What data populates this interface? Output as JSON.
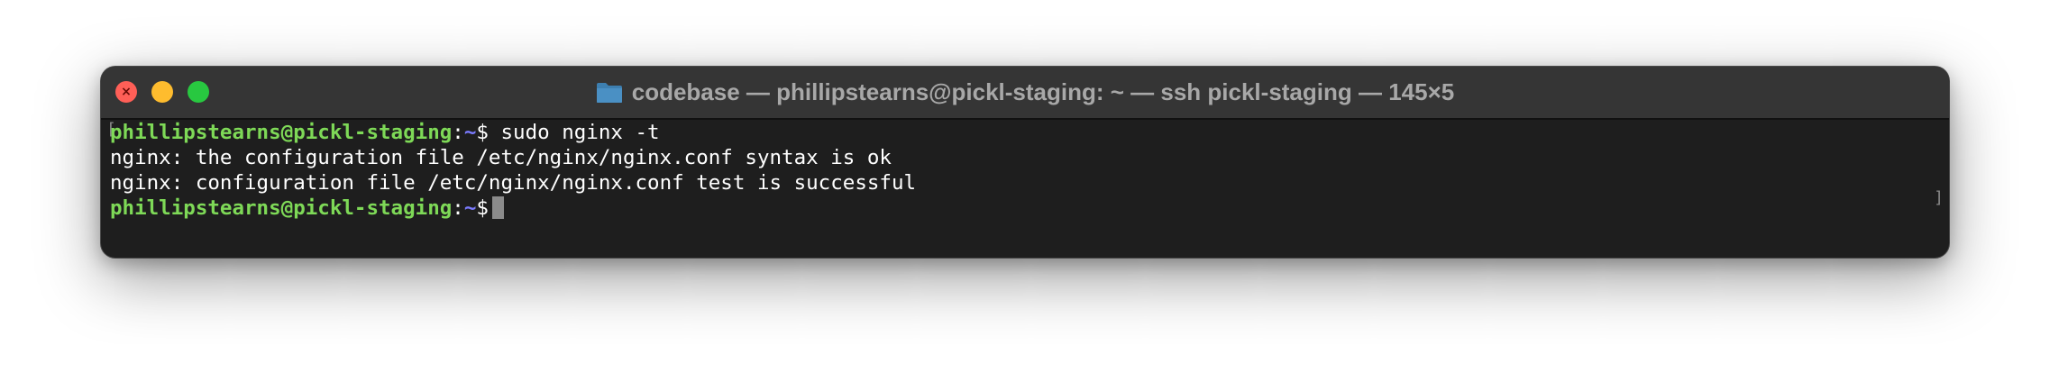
{
  "window": {
    "title": "codebase — phillipstearns@pickl-staging: ~ — ssh pickl-staging — 145×5",
    "close_glyph": "×",
    "folder_icon": "folder-icon"
  },
  "terminal": {
    "prompt_user_host": "phillipstearns@pickl-staging",
    "prompt_colon": ":",
    "prompt_path": "~",
    "prompt_dollar": "$",
    "command": " sudo nginx -t",
    "output": [
      "nginx: the configuration file /etc/nginx/nginx.conf syntax is ok",
      "nginx: configuration file /etc/nginx/nginx.conf test is successful"
    ],
    "colors": {
      "user": "#7ed957",
      "path": "#7b7bff",
      "text": "#ffffff",
      "background": "#1e1e1e"
    }
  }
}
